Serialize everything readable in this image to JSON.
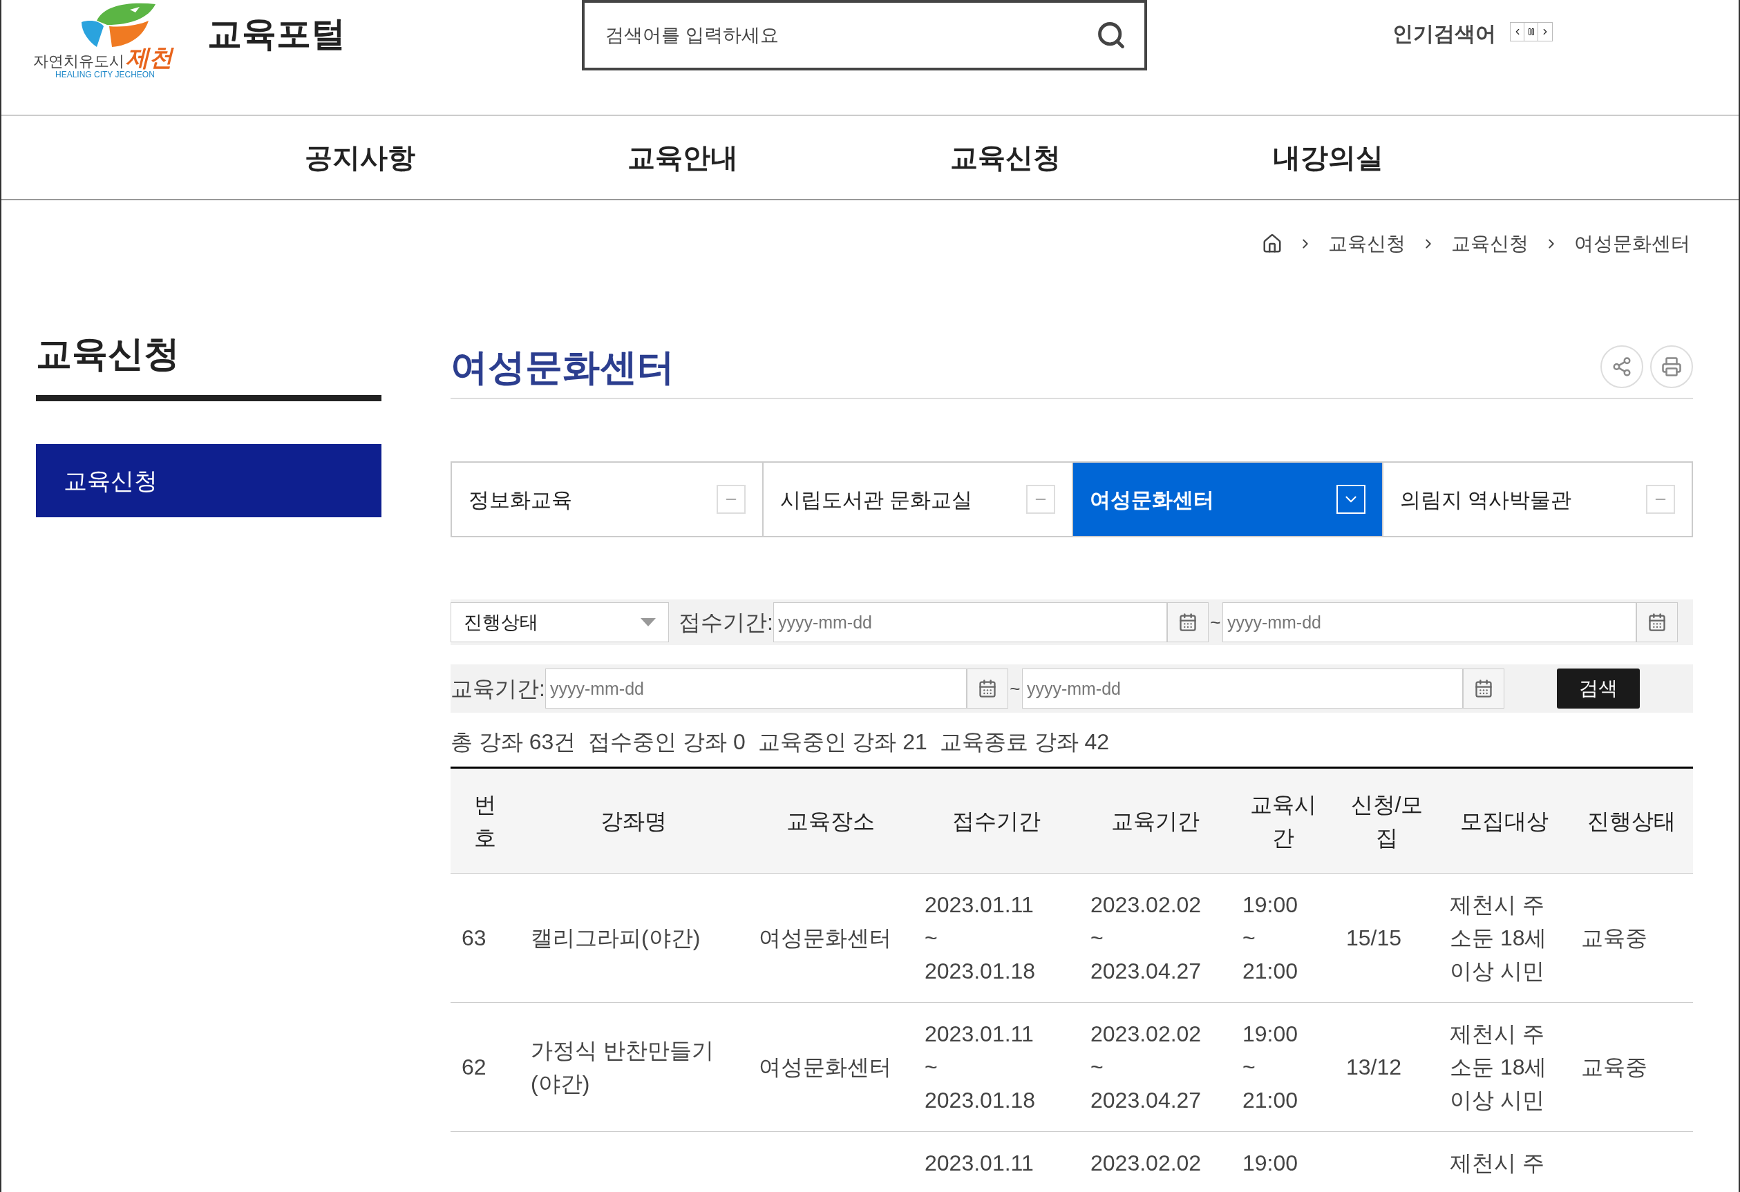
{
  "header": {
    "logo": {
      "slogan": "자연치유도시",
      "city": "제천",
      "subtitle": "HEALING CITY JECHEON"
    },
    "site_title": "교육포털",
    "search": {
      "placeholder": "검색어를 입력하세요"
    },
    "popular_label": "인기검색어"
  },
  "nav": [
    "공지사항",
    "교육안내",
    "교육신청",
    "내강의실"
  ],
  "breadcrumb": [
    "교육신청",
    "교육신청",
    "여성문화센터"
  ],
  "sidebar": {
    "title": "교육신청",
    "items": [
      {
        "label": "교육신청",
        "selected": true
      }
    ]
  },
  "page_title": "여성문화센터",
  "tabs": [
    {
      "label": "정보화교육",
      "selected": false
    },
    {
      "label": "시립도서관 문화교실",
      "selected": false
    },
    {
      "label": "여성문화센터",
      "selected": true
    },
    {
      "label": "의림지 역사박물관",
      "selected": false
    }
  ],
  "filters": {
    "status": {
      "placeholder": "진행상태"
    },
    "apply_label": "접수기간:",
    "apply_from": {
      "placeholder": "yyyy-mm-dd"
    },
    "apply_sep": "~",
    "apply_to": {
      "placeholder": "yyyy-mm-dd"
    },
    "edu_label": "교육기간:",
    "edu_from": {
      "placeholder": "yyyy-mm-dd"
    },
    "edu_sep": "~",
    "edu_to": {
      "placeholder": "yyyy-mm-dd"
    },
    "search_button": "검색"
  },
  "summary": "총 강좌 63건  접수중인 강좌 0  교육중인 강좌 21  교육종료 강좌 42",
  "table": {
    "columns": [
      "번호",
      "강좌명",
      "교육장소",
      "접수기간",
      "교육기간",
      "교육시간",
      "신청/모집",
      "모집대상",
      "진행상태"
    ],
    "rows": [
      {
        "number": "63",
        "title": "캘리그라피(야간)",
        "place": "여성문화센터",
        "apply_period": "2023.01.11 ~ 2023.01.18",
        "edu_period": "2023.02.02 ~ 2023.04.27",
        "time": "19:00 ~ 21:00",
        "count": "15/15",
        "target": "제천시 주소둔 18세 이상 시민",
        "status": "교육중"
      },
      {
        "number": "62",
        "title": "가정식 반찬만들기(야간)",
        "place": "여성문화센터",
        "apply_period": "2023.01.11 ~ 2023.01.18",
        "edu_period": "2023.02.02 ~ 2023.04.27",
        "time": "19:00 ~ 21:00",
        "count": "13/12",
        "target": "제천시 주소둔 18세 이상 시민",
        "status": "교육중"
      },
      {
        "apply_period": "2023.01.11",
        "edu_period": "2023.02.02",
        "time": "19:00",
        "target": "제천시 주"
      }
    ]
  }
}
